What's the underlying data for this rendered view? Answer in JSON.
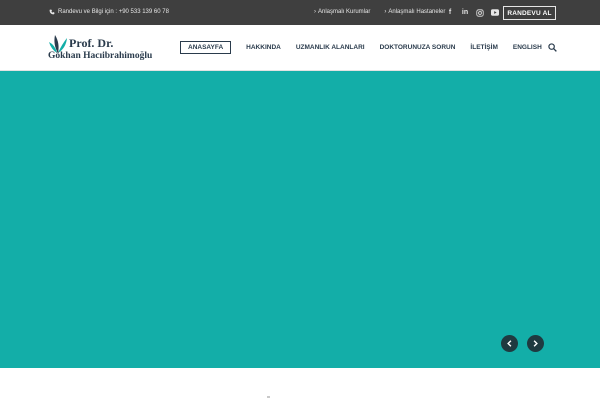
{
  "topbar": {
    "contact_label": "Randevu ve Bilgi için : +90 533 139 60 78",
    "links": [
      "Anlaşmalı Kurumlar",
      "Anlaşmalı Hastaneler"
    ],
    "social_icons": [
      "facebook-icon",
      "linkedin-icon",
      "instagram-icon",
      "youtube-icon"
    ],
    "cta_label": "RANDEVU AL"
  },
  "logo": {
    "line1": "Prof. Dr.",
    "line2": "Gökhan Hacıibrahimoğlu"
  },
  "nav": {
    "items": [
      "ANASAYFA",
      "HAKKINDA",
      "UZMANLIK ALANLARI",
      "DOKTORUNUZA SORUN",
      "İLETİŞİM",
      "ENGLISH"
    ],
    "active_index": 0
  },
  "hero": {
    "background_color": "#13aea8"
  },
  "colors": {
    "topbar": "#3f3f3f",
    "brand_dark": "#2a3b4c",
    "accent": "#13aea8",
    "slider_button": "#1f3a40"
  }
}
